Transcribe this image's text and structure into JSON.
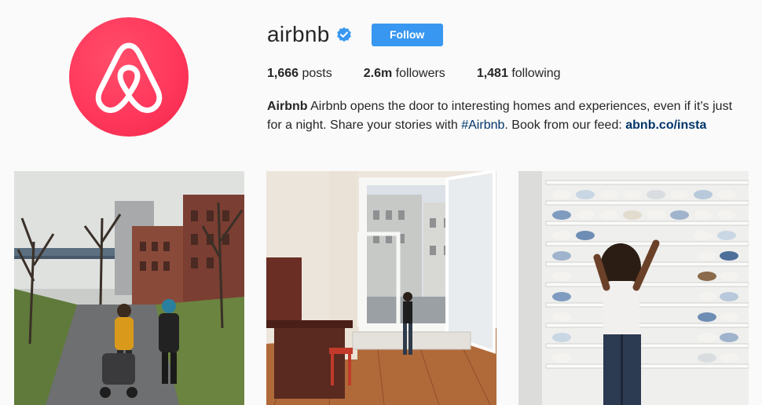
{
  "profile": {
    "username": "airbnb",
    "follow_label": "Follow",
    "stats": {
      "posts_count": "1,666",
      "posts_label": "posts",
      "followers_count": "2.6m",
      "followers_label": "followers",
      "following_count": "1,481",
      "following_label": "following"
    },
    "bio": {
      "name": "Airbnb",
      "text_1": "Airbnb opens the door to interesting homes and experiences, even if it’s just for a night. Share your stories with",
      "hashtag": "#Airbnb",
      "text_2": ". Book from our feed:",
      "link": "abnb.co/insta"
    }
  },
  "colors": {
    "brand": "#ff385c",
    "follow_button": "#3897f0",
    "verified_badge": "#3897f0",
    "link": "#003569"
  },
  "icons": {
    "avatar_logo": "airbnb-belo-logo-icon",
    "verified": "verified-badge-icon"
  },
  "posts": [
    {
      "id": "post-1",
      "subject": "street-walk"
    },
    {
      "id": "post-2",
      "subject": "window-room"
    },
    {
      "id": "post-3",
      "subject": "pottery-shelf"
    }
  ]
}
